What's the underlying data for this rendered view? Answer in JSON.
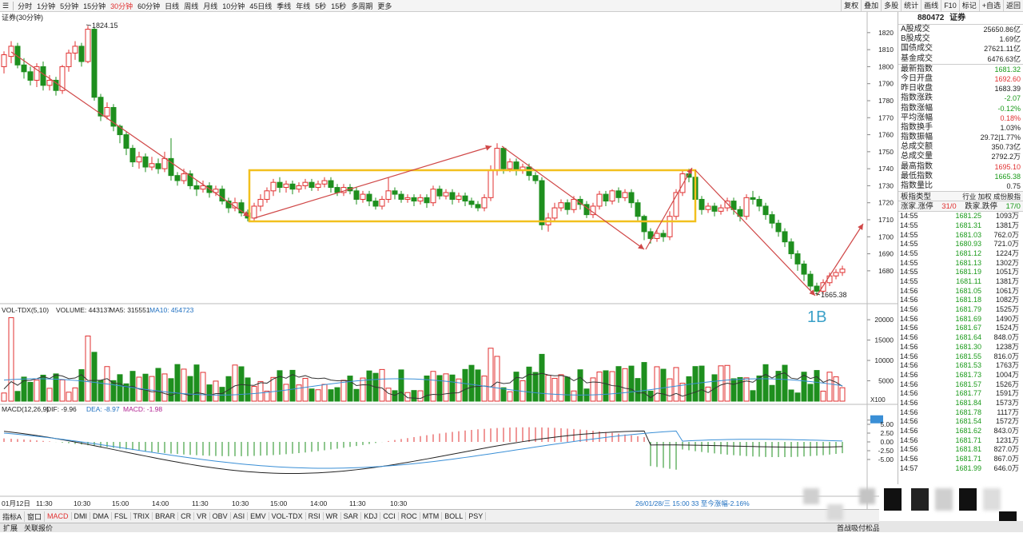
{
  "toolbar": {
    "items": [
      {
        "label": "分时"
      },
      {
        "label": "1分钟"
      },
      {
        "label": "5分钟"
      },
      {
        "label": "15分钟"
      },
      {
        "label": "30分钟",
        "active": true
      },
      {
        "label": "60分钟"
      },
      {
        "label": "日线"
      },
      {
        "label": "周线"
      },
      {
        "label": "月线"
      },
      {
        "label": "10分钟"
      },
      {
        "label": "45日线"
      },
      {
        "label": "季线"
      },
      {
        "label": "年线"
      },
      {
        "label": "5秒"
      },
      {
        "label": "15秒"
      },
      {
        "label": "多周期"
      },
      {
        "label": "更多"
      }
    ],
    "right_buttons": [
      "复权",
      "叠加",
      "多股",
      "统计",
      "画线",
      "F10",
      "标记",
      "+自选",
      "返回"
    ]
  },
  "chart_title": "证券(30分钟)",
  "price_panel": {
    "high_label": "1824.15",
    "low_label": "1665.38",
    "annotation": "1B",
    "y_ticks": [
      "1820",
      "1810",
      "1800",
      "1790",
      "1780",
      "1770",
      "1760",
      "1750",
      "1740",
      "1730",
      "1720",
      "1710",
      "1700",
      "1690",
      "1680"
    ]
  },
  "volume_panel": {
    "header": {
      "name": "VOL-TDX(5,10)",
      "volume": "VOLUME: 443137",
      "ma5": "MA5: 315551",
      "ma10": "MA10: 454723"
    },
    "y_ticks": [
      "20000",
      "15000",
      "10000",
      "5000"
    ],
    "unit": "X100"
  },
  "macd_panel": {
    "header": {
      "name": "MACD(12,26,9)",
      "dif": "DIF: -9.96",
      "dea": "DEA: -8.97",
      "macd": "MACD: -1.98"
    },
    "y_ticks": [
      "6.2",
      "5.00",
      "2.50",
      "0.00",
      "-2.50",
      "-5.00"
    ]
  },
  "x_axis": {
    "labels": [
      "01月12日",
      "11:30",
      "10:30",
      "15:00",
      "14:00",
      "11:30",
      "10:30",
      "15:00",
      "14:00",
      "11:30",
      "10:30"
    ],
    "info": "26/01/28/三 15:00 33 至今涨幅-2.16%"
  },
  "bottom_tabs": [
    "指标A",
    "窗口",
    "MACD",
    "DMI",
    "DMA",
    "FSL",
    "TRIX",
    "BRAR",
    "CR",
    "VR",
    "OBV",
    "ASI",
    "EMV",
    "VOL-TDX",
    "RSI",
    "WR",
    "SAR",
    "KDJ",
    "CCI",
    "ROC",
    "MTM",
    "BOLL",
    "PSY"
  ],
  "status_bar": [
    "扩展",
    "关联报价"
  ],
  "status_right": "首战吸付松品说明",
  "side": {
    "code": "880472",
    "name": "证券",
    "stats": [
      {
        "label": "A股成交",
        "value": "25650.86亿",
        "color": "normal"
      },
      {
        "label": "B股成交",
        "value": "1.69亿",
        "color": "normal"
      },
      {
        "label": "国债成交",
        "value": "27621.11亿",
        "color": "normal"
      },
      {
        "label": "基金成交",
        "value": "6476.63亿",
        "color": "normal"
      }
    ],
    "index_stats": [
      {
        "label": "最新指数",
        "value": "1681.32",
        "color": "green"
      },
      {
        "label": "今日开盘",
        "value": "1692.60",
        "color": "red"
      },
      {
        "label": "昨日收盘",
        "value": "1683.39",
        "color": "normal"
      },
      {
        "label": "指数涨跌",
        "value": "-2.07",
        "color": "green"
      },
      {
        "label": "指数涨幅",
        "value": "-0.12%",
        "color": "green"
      },
      {
        "label": "平均涨幅",
        "value": "0.18%",
        "color": "red"
      },
      {
        "label": "指数换手",
        "value": "1.03%",
        "color": "normal"
      },
      {
        "label": "指数振幅",
        "value": "29.72|1.77%",
        "color": "normal"
      },
      {
        "label": "总成交额",
        "value": "350.73亿",
        "color": "normal"
      },
      {
        "label": "总成交量",
        "value": "2792.2万",
        "color": "normal"
      },
      {
        "label": "最高指数",
        "value": "1695.10",
        "color": "red"
      },
      {
        "label": "最低指数",
        "value": "1665.38",
        "color": "green"
      },
      {
        "label": "指数量比",
        "value": "0.75",
        "color": "normal"
      }
    ],
    "sector_row": {
      "label": "板指类型",
      "value": "行业 加权 成份股指"
    },
    "updown_row": {
      "a": "涨家.涨停",
      "b": "31/0",
      "c": "跌家.跌停",
      "d": "17/0"
    },
    "ticks": [
      {
        "t": "14:55",
        "p": "1681.25",
        "q": "1093万"
      },
      {
        "t": "14:55",
        "p": "1681.31",
        "q": "1381万"
      },
      {
        "t": "14:55",
        "p": "1681.03",
        "q": "762.0万"
      },
      {
        "t": "14:55",
        "p": "1680.93",
        "q": "721.0万"
      },
      {
        "t": "14:55",
        "p": "1681.12",
        "q": "1224万"
      },
      {
        "t": "14:55",
        "p": "1681.13",
        "q": "1302万"
      },
      {
        "t": "14:55",
        "p": "1681.19",
        "q": "1051万"
      },
      {
        "t": "14:55",
        "p": "1681.11",
        "q": "1381万"
      },
      {
        "t": "14:56",
        "p": "1681.05",
        "q": "1061万"
      },
      {
        "t": "14:56",
        "p": "1681.18",
        "q": "1082万"
      },
      {
        "t": "14:56",
        "p": "1681.79",
        "q": "1525万"
      },
      {
        "t": "14:56",
        "p": "1681.69",
        "q": "1490万"
      },
      {
        "t": "14:56",
        "p": "1681.67",
        "q": "1524万"
      },
      {
        "t": "14:56",
        "p": "1681.64",
        "q": "848.0万"
      },
      {
        "t": "14:56",
        "p": "1681.30",
        "q": "1238万"
      },
      {
        "t": "14:56",
        "p": "1681.55",
        "q": "816.0万"
      },
      {
        "t": "14:56",
        "p": "1681.53",
        "q": "1763万"
      },
      {
        "t": "14:56",
        "p": "1681.73",
        "q": "1004万"
      },
      {
        "t": "14:56",
        "p": "1681.57",
        "q": "1526万"
      },
      {
        "t": "14:56",
        "p": "1681.77",
        "q": "1591万"
      },
      {
        "t": "14:56",
        "p": "1681.84",
        "q": "1573万"
      },
      {
        "t": "14:56",
        "p": "1681.78",
        "q": "1117万"
      },
      {
        "t": "14:56",
        "p": "1681.54",
        "q": "1572万"
      },
      {
        "t": "14:56",
        "p": "1681.62",
        "q": "843.0万"
      },
      {
        "t": "14:56",
        "p": "1681.71",
        "q": "1231万"
      },
      {
        "t": "14:56",
        "p": "1681.81",
        "q": "827.0万"
      },
      {
        "t": "14:56",
        "p": "1681.71",
        "q": "867.0万"
      },
      {
        "t": "14:57",
        "p": "1681.99",
        "q": "646.0万"
      }
    ]
  },
  "colors": {
    "up": "#e03030",
    "down": "#1e8f1e",
    "box": "#f2c01e",
    "arrow": "#d04848",
    "ma5": "#333333",
    "ma10": "#3a8fd6"
  }
}
